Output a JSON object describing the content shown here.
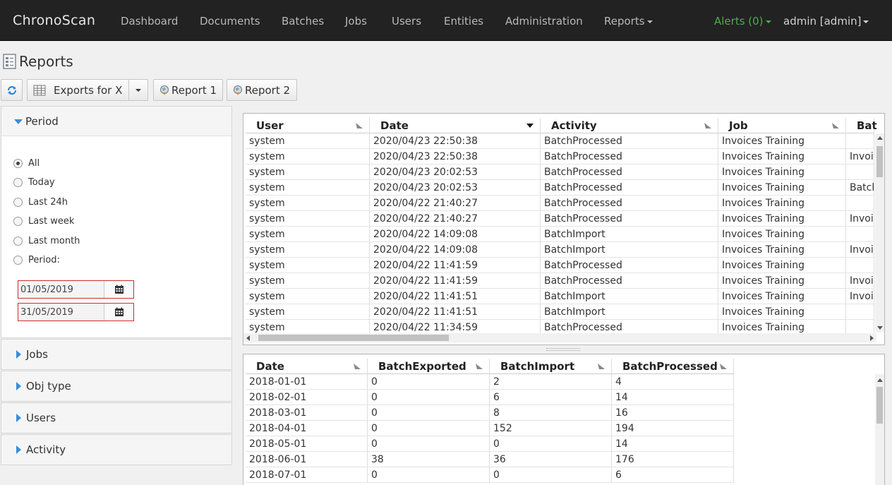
{
  "nav": {
    "brand": "ChronoScan",
    "items": [
      "Dashboard",
      "Documents",
      "Batches",
      "Jobs",
      "Users",
      "Entities",
      "Administration",
      "Reports"
    ],
    "alerts": "Alerts (0)",
    "user": "admin [admin]"
  },
  "page": {
    "title": "Reports"
  },
  "toolbar": {
    "report_select": "Exports for X",
    "report1": "Report 1",
    "report2": "Report 2"
  },
  "filters": {
    "period_label": "Period",
    "options": [
      "All",
      "Today",
      "Last 24h",
      "Last week",
      "Last month",
      "Period:"
    ],
    "selected": "All",
    "date_from": "01/05/2019",
    "date_to": "31/05/2019",
    "sections": [
      "Jobs",
      "Obj type",
      "Users",
      "Activity"
    ]
  },
  "activity_grid": {
    "columns": [
      "User",
      "Date",
      "Activity",
      "Job",
      "Bat"
    ],
    "rows": [
      [
        "system",
        "2020/04/23 22:50:38",
        "BatchProcessed",
        "Invoices Training",
        ""
      ],
      [
        "system",
        "2020/04/23 22:50:38",
        "BatchProcessed",
        "Invoices Training",
        "Invoi"
      ],
      [
        "system",
        "2020/04/23 20:02:53",
        "BatchProcessed",
        "Invoices Training",
        ""
      ],
      [
        "system",
        "2020/04/23 20:02:53",
        "BatchProcessed",
        "Invoices Training",
        "Batch"
      ],
      [
        "system",
        "2020/04/22 21:40:27",
        "BatchProcessed",
        "Invoices Training",
        ""
      ],
      [
        "system",
        "2020/04/22 21:40:27",
        "BatchProcessed",
        "Invoices Training",
        "Invoi"
      ],
      [
        "system",
        "2020/04/22 14:09:08",
        "BatchImport",
        "Invoices Training",
        ""
      ],
      [
        "system",
        "2020/04/22 14:09:08",
        "BatchImport",
        "Invoices Training",
        "Invoi"
      ],
      [
        "system",
        "2020/04/22 11:41:59",
        "BatchProcessed",
        "Invoices Training",
        ""
      ],
      [
        "system",
        "2020/04/22 11:41:59",
        "BatchProcessed",
        "Invoices Training",
        "Invoi"
      ],
      [
        "system",
        "2020/04/22 11:41:51",
        "BatchImport",
        "Invoices Training",
        "Invoi"
      ],
      [
        "system",
        "2020/04/22 11:41:51",
        "BatchImport",
        "Invoices Training",
        ""
      ],
      [
        "system",
        "2020/04/22 11:34:59",
        "BatchProcessed",
        "Invoices Training",
        ""
      ]
    ]
  },
  "summary_grid": {
    "columns": [
      "Date",
      "BatchExported",
      "BatchImport",
      "BatchProcessed"
    ],
    "rows": [
      [
        "2018-01-01",
        "0",
        "2",
        "4"
      ],
      [
        "2018-02-01",
        "0",
        "6",
        "14"
      ],
      [
        "2018-03-01",
        "0",
        "8",
        "16"
      ],
      [
        "2018-04-01",
        "0",
        "152",
        "194"
      ],
      [
        "2018-05-01",
        "0",
        "0",
        "14"
      ],
      [
        "2018-06-01",
        "38",
        "36",
        "176"
      ],
      [
        "2018-07-01",
        "0",
        "0",
        "6"
      ]
    ]
  },
  "colors": {
    "navbar": "#222222",
    "alerts": "#4cae4c",
    "accent": "#3a8ed8",
    "invalid_border": "#c9302c"
  }
}
